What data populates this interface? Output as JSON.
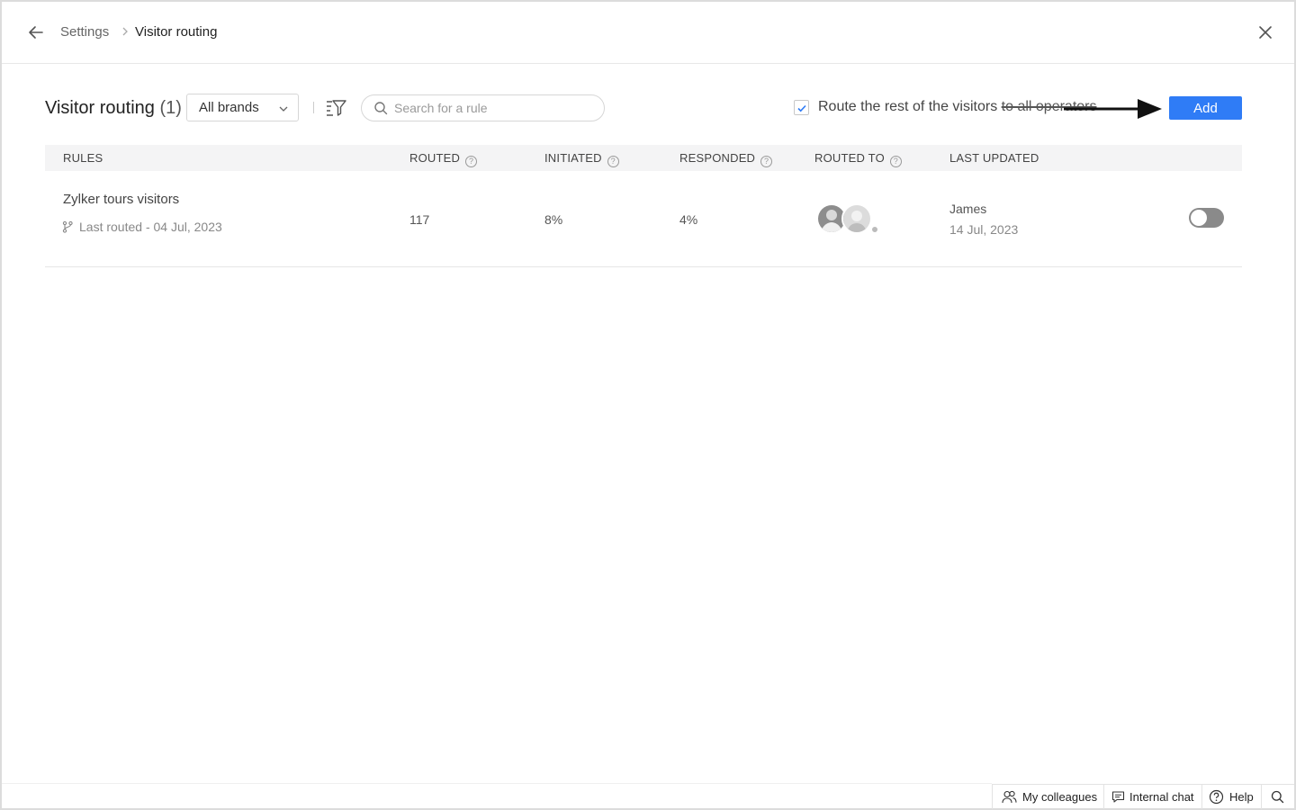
{
  "breadcrumb": {
    "parent": "Settings",
    "current": "Visitor routing"
  },
  "toolbar": {
    "title": "Visitor routing",
    "count": "(1)",
    "brand_filter": "All brands",
    "search_placeholder": "Search for a rule",
    "route_rest_label_main": "Route the rest of the visitors ",
    "route_rest_label_struck": "to all operators",
    "route_rest_checked": true,
    "add_label": "Add",
    "accent_color": "#2f7cf6"
  },
  "table": {
    "headers": {
      "rules": "RULES",
      "routed": "ROUTED",
      "initiated": "INITIATED",
      "responded": "RESPONDED",
      "routed_to": "ROUTED TO",
      "last_updated": "LAST UPDATED"
    },
    "rows": [
      {
        "name": "Zylker tours visitors",
        "last_routed": "Last routed - 04 Jul, 2023",
        "routed": "117",
        "initiated": "8%",
        "responded": "4%",
        "updated_by": "James",
        "updated_on": "14 Jul, 2023",
        "enabled": false
      }
    ]
  },
  "footer": {
    "colleagues": "My colleagues",
    "internal_chat": "Internal chat",
    "help": "Help"
  }
}
